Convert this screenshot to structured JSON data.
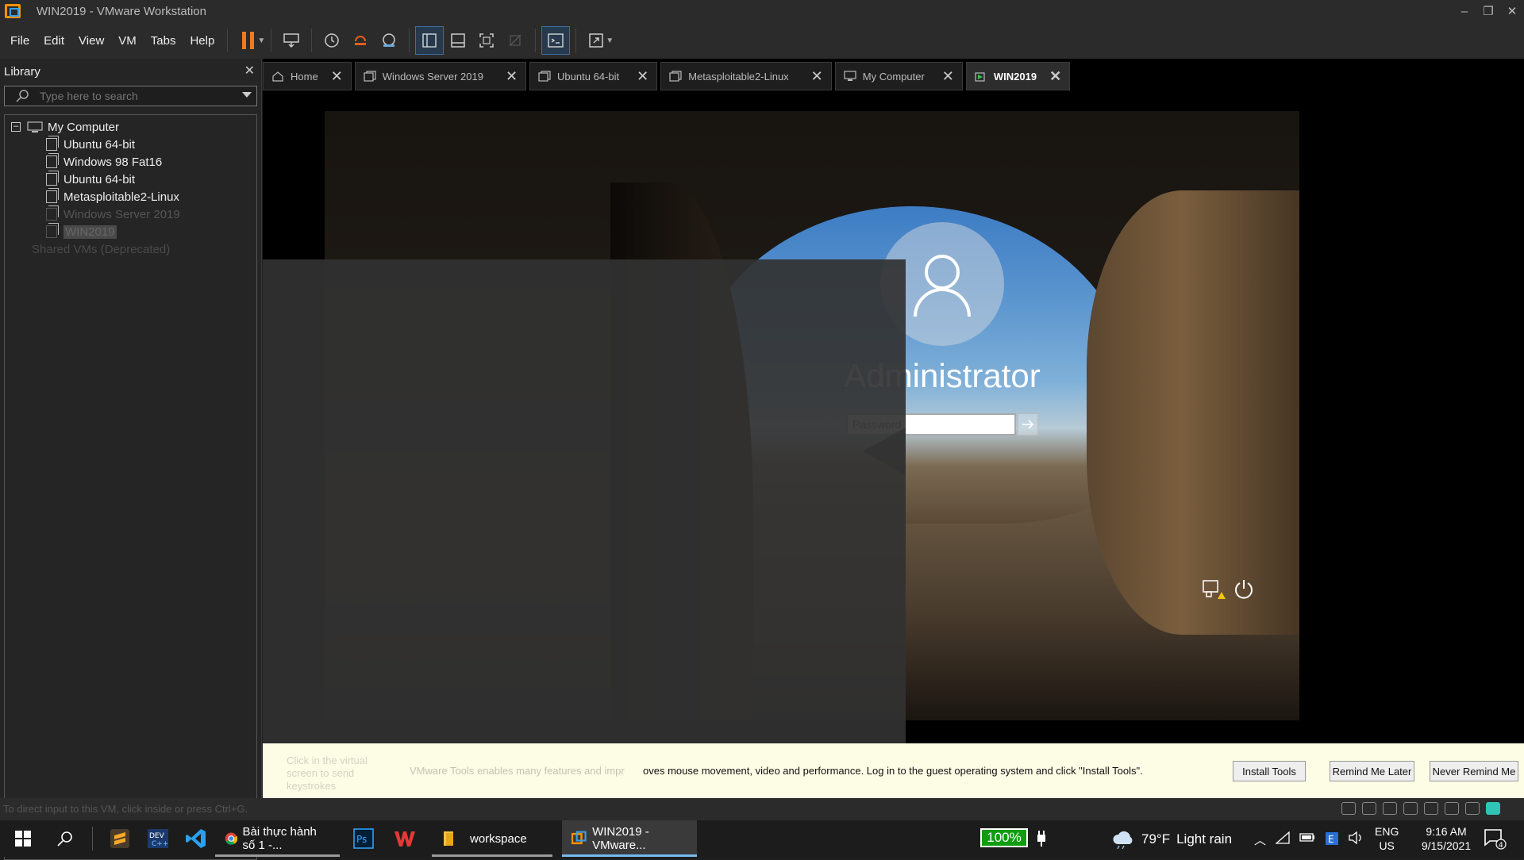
{
  "window": {
    "title": "WIN2019 - VMware Workstation",
    "controls": [
      "–",
      "❐",
      "✕"
    ]
  },
  "menu": [
    "File",
    "Edit",
    "View",
    "VM",
    "Tabs",
    "Help"
  ],
  "library": {
    "title": "Library",
    "search_placeholder": "Type here to search",
    "tree": {
      "root": "My Computer",
      "items": [
        "Ubuntu 64-bit",
        "Windows 98 Fat16",
        "Ubuntu 64-bit",
        "Metasploitable2-Linux",
        "Windows Server 2019",
        "WIN2019"
      ],
      "shared": "Shared VMs (Deprecated)"
    }
  },
  "tabs": [
    {
      "label": "Home",
      "icon": "home-icon"
    },
    {
      "label": "Windows Server 2019",
      "icon": "vm-icon"
    },
    {
      "label": "Ubuntu 64-bit",
      "icon": "vm-icon"
    },
    {
      "label": "Metasploitable2-Linux",
      "icon": "vm-icon"
    },
    {
      "label": "My Computer",
      "icon": "computer-icon"
    },
    {
      "label": "WIN2019",
      "icon": "vm-running-icon",
      "active": true
    }
  ],
  "login": {
    "username": "Administrator",
    "password_placeholder": "Password"
  },
  "tools_bar": {
    "hint": "Click in the virtual screen to send keystrokes",
    "message": "VMware Tools enables many features and improves mouse movement, video and performance. Log in to the guest operating system and click \"Install Tools\".",
    "message_visible": "oves mouse movement, video and performance. Log in to the guest operating system and click \"Install Tools\".",
    "message_faded": "VMware Tools enables many features and impr",
    "install": "Install Tools",
    "remind_later": "Remind Me Later",
    "never_remind": "Never Remind Me"
  },
  "status": {
    "text": "To direct input to this VM, click inside or press Ctrl+G."
  },
  "taskbar": {
    "apps": [
      {
        "label": "Bài thực hành số 1 -...",
        "icon": "chrome-icon"
      },
      {
        "label": "workspace",
        "icon": "folder-icon"
      },
      {
        "label": "WIN2019 - VMware...",
        "icon": "vmware-icon",
        "active": true
      }
    ],
    "battery": "100%",
    "weather": {
      "temp": "79°F",
      "desc": "Light rain"
    },
    "lang": {
      "l1": "ENG",
      "l2": "US"
    },
    "clock": {
      "time": "9:16 AM",
      "date": "9/15/2021"
    },
    "notifications": "4"
  },
  "colors": {
    "accent": "#f07a1e",
    "tab_active_bg": "#2d2d2d",
    "tools_bar_bg": "#fdfde6",
    "battery_green": "#0f9d0f"
  }
}
